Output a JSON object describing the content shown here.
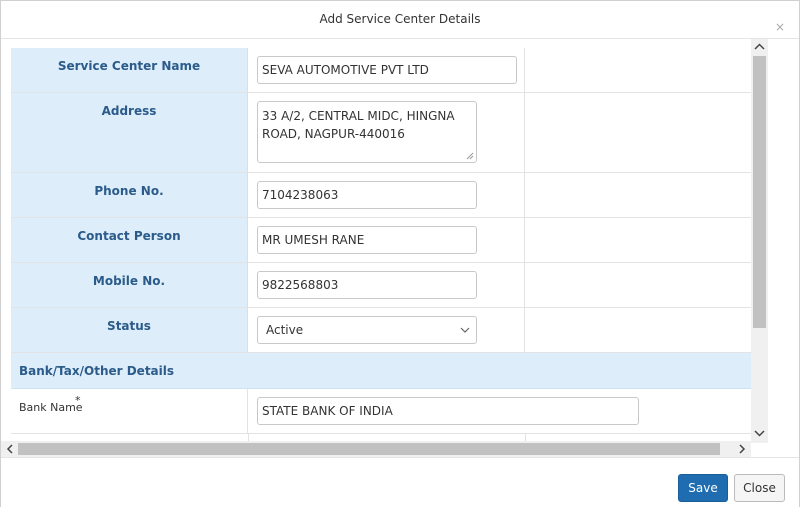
{
  "dialog": {
    "title": "Add Service Center Details",
    "close_glyph": "×"
  },
  "form": {
    "service_center_name": {
      "label": "Service Center Name",
      "value": "SEVA AUTOMOTIVE PVT LTD"
    },
    "address": {
      "label": "Address",
      "line1": "33 A/2, CENTRAL MIDC, HINGNA",
      "line2": "ROAD, NAGPUR-440016"
    },
    "phone": {
      "label": "Phone No.",
      "value": "7104238063"
    },
    "contact_person": {
      "label": "Contact Person",
      "value": "MR UMESH RANE"
    },
    "mobile": {
      "label": "Mobile No.",
      "value": "9822568803"
    },
    "status": {
      "label": "Status",
      "value": "Active"
    }
  },
  "bank_section": {
    "title": "Bank/Tax/Other Details",
    "bank_name": {
      "label": "Bank Name",
      "required_mark": "*",
      "value": "STATE BANK OF INDIA"
    }
  },
  "scrollbars": {
    "up": "▲",
    "down": "▼",
    "left": "◀",
    "right": "▶"
  },
  "footer": {
    "save_label": "Save",
    "close_label": "Close"
  },
  "colors": {
    "label_bg": "#ddeefa",
    "label_text": "#2b5b8a",
    "primary": "#1f6db0"
  }
}
